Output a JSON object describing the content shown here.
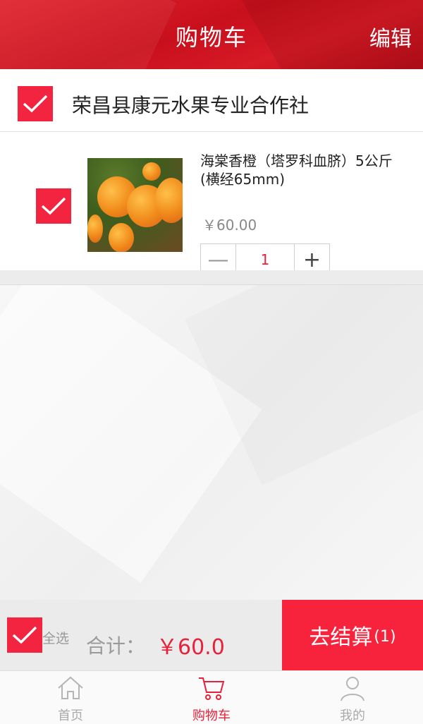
{
  "header": {
    "title": "购物车",
    "edit_label": "编辑"
  },
  "shop": {
    "name": "荣昌县康元水果专业合作社",
    "checked": true
  },
  "items": [
    {
      "name": "海棠香橙（塔罗科血脐）5公斤(横经65mm)",
      "price": "￥60.00",
      "quantity": "1",
      "checked": true
    }
  ],
  "stepper": {
    "minus": "—",
    "plus": "+"
  },
  "summary": {
    "select_all_label": "全选",
    "total_label": "合计：",
    "total_value": "￥60.0",
    "checkout_label": "去结算",
    "checkout_count": "(1)"
  },
  "tabs": [
    {
      "label": "首页",
      "icon": "home-icon",
      "active": false
    },
    {
      "label": "购物车",
      "icon": "cart-icon",
      "active": true
    },
    {
      "label": "我的",
      "icon": "user-icon",
      "active": false
    }
  ],
  "colors": {
    "accent": "#f22440",
    "header": "#d01623",
    "price_red": "#e8213a"
  }
}
